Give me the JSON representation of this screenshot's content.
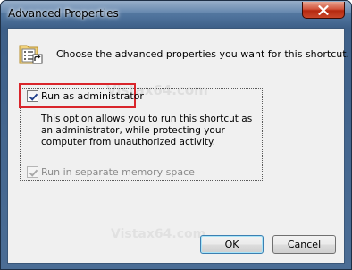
{
  "window": {
    "title": "Advanced Properties",
    "close_icon": "close-icon"
  },
  "header": {
    "icon": "shortcut-properties-icon",
    "text": "Choose the advanced properties you want for this shortcut."
  },
  "options": {
    "run_as_admin": {
      "label": "Run as administrator",
      "checked": true,
      "enabled": true,
      "description": "This option allows you to run this shortcut as an administrator, while protecting your computer from unauthorized activity."
    },
    "separate_memory": {
      "label": "Run in separate memory space",
      "checked": true,
      "enabled": false
    }
  },
  "buttons": {
    "ok": "OK",
    "cancel": "Cancel"
  },
  "watermark": "Vistax64.com",
  "colors": {
    "highlight": "#d9252b",
    "dialog_background": "#f0f0f0",
    "close_button": "#c8462a"
  }
}
